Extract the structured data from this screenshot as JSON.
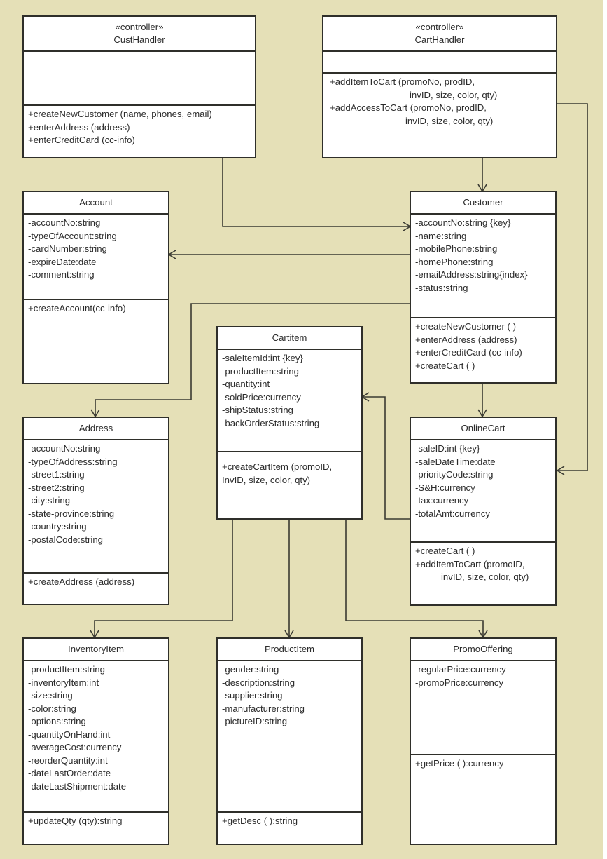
{
  "diagram": {
    "type": "UML class diagram",
    "colors": {
      "background": "#e5e0b7",
      "box_fill": "#ffffff",
      "stroke": "#2f2f2a",
      "text": "#2b2b2b"
    },
    "classes": {
      "custHandler": {
        "stereotype": "«controller»",
        "name": "CustHandler",
        "attributes": [],
        "operations": [
          "+createNewCustomer (name, phones, email)",
          "+enterAddress (address)",
          "+enterCreditCard (cc-info)"
        ]
      },
      "cartHandler": {
        "stereotype": "«controller»",
        "name": "CartHandler",
        "attributes": [],
        "operations": [
          "+addItemToCart (promoNo, prodID,",
          "invID, size, color, qty)",
          "+addAccessToCart (promoNo, prodID,",
          "invID, size, color, qty)"
        ]
      },
      "account": {
        "name": "Account",
        "attributes": [
          "-accountNo:string",
          "-typeOfAccount:string",
          "-cardNumber:string",
          "-expireDate:date",
          "-comment:string"
        ],
        "operations": [
          "+createAccount(cc-info)"
        ]
      },
      "customer": {
        "name": "Customer",
        "attributes": [
          "-accountNo:string {key}",
          "-name:string",
          "-mobilePhone:string",
          "-homePhone:string",
          "-emailAddress:string{index}",
          "-status:string"
        ],
        "operations": [
          "+createNewCustomer ( )",
          "+enterAddress (address)",
          "+enterCreditCard (cc-info)",
          "+createCart ( )"
        ]
      },
      "cartItem": {
        "name": "Cartitem",
        "attributes": [
          "-saleItemId:int {key}",
          "-productItem:string",
          "-quantity:int",
          "-soldPrice:currency",
          "-shipStatus:string",
          "-backOrderStatus:string"
        ],
        "operations": [
          "+createCartItem (promoID,",
          "InvID, size, color, qty)"
        ]
      },
      "address": {
        "name": "Address",
        "attributes": [
          "-accountNo:string",
          "-typeOfAddress:string",
          "-street1:string",
          "-street2:string",
          "-city:string",
          "-state-province:string",
          "-country:string",
          "-postalCode:string"
        ],
        "operations": [
          "+createAddress (address)"
        ]
      },
      "onlineCart": {
        "name": "OnlineCart",
        "attributes": [
          "-saleID:int {key}",
          "-saleDateTime:date",
          "-priorityCode:string",
          "-S&H:currency",
          "-tax:currency",
          "-totalAmt:currency"
        ],
        "operations": [
          "+createCart ( )",
          "+addItemToCart (promoID,",
          "invID, size, color, qty)"
        ]
      },
      "inventoryItem": {
        "name": "InventoryItem",
        "attributes": [
          "-productItem:string",
          "-inventoryItem:int",
          "-size:string",
          "-color:string",
          "-options:string",
          "-quantityOnHand:int",
          "-averageCost:currency",
          "-reorderQuantity:int",
          "-dateLastOrder:date",
          "-dateLastShipment:date"
        ],
        "operations": [
          "+updateQty (qty):string"
        ]
      },
      "productItem": {
        "name": "ProductItem",
        "attributes": [
          "-gender:string",
          "-description:string",
          "-supplier:string",
          "-manufacturer:string",
          "-pictureID:string"
        ],
        "operations": [
          "+getDesc ( ):string"
        ]
      },
      "promoOffering": {
        "name": "PromoOffering",
        "attributes": [
          "-regularPrice:currency",
          "-promoPrice:currency"
        ],
        "operations": [
          "+getPrice ( ):currency"
        ]
      }
    },
    "associations": [
      {
        "from": "CustHandler",
        "to": "Customer",
        "arrow": "open"
      },
      {
        "from": "CartHandler",
        "to": "Customer",
        "arrow": "open"
      },
      {
        "from": "CartHandler",
        "to": "OnlineCart",
        "arrow": "open"
      },
      {
        "from": "Customer",
        "to": "Account",
        "arrow": "open"
      },
      {
        "from": "Customer",
        "to": "Address",
        "arrow": "open"
      },
      {
        "from": "Customer",
        "to": "OnlineCart",
        "arrow": "open"
      },
      {
        "from": "OnlineCart",
        "to": "Cartitem",
        "arrow": "open"
      },
      {
        "from": "Cartitem",
        "to": "InventoryItem",
        "arrow": "open"
      },
      {
        "from": "Cartitem",
        "to": "ProductItem",
        "arrow": "open"
      },
      {
        "from": "Cartitem",
        "to": "PromoOffering",
        "arrow": "open"
      }
    ]
  }
}
